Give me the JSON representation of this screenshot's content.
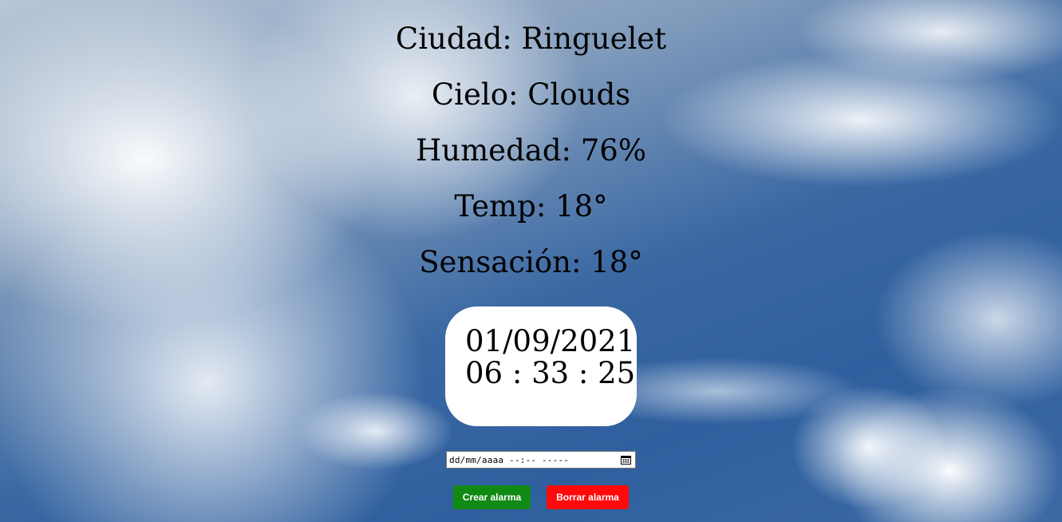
{
  "weather": {
    "city": "Ciudad: Ringuelet",
    "sky": "Cielo: Clouds",
    "humidity": "Humedad: 76%",
    "temp": "Temp: 18°",
    "feels_like": "Sensación: 18°"
  },
  "clock": {
    "date": "01/09/2021",
    "time": "06 : 33 : 25"
  },
  "alarm": {
    "input_value": "dd/mm/aaaa --:-- -----",
    "create_label": "Crear alarma",
    "delete_label": "Borrar alarma"
  },
  "icons": {
    "calendar": "calendar-icon"
  },
  "colors": {
    "create_button": "#118a13",
    "delete_button": "#ff0a0a",
    "clock_background": "#ffffff"
  }
}
